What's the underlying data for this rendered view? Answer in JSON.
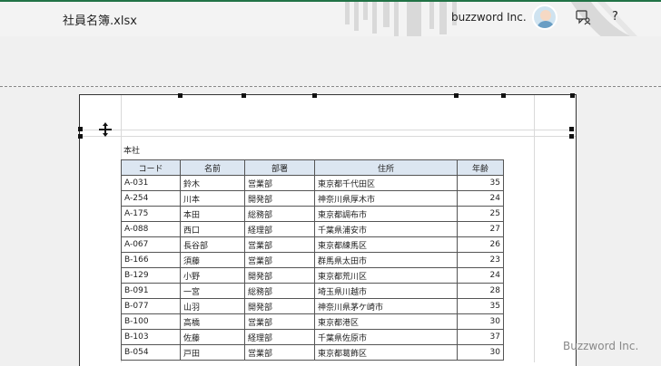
{
  "titlebar": {
    "filename": "社員名簿.xlsx",
    "username": "buzzword Inc.",
    "help": "?"
  },
  "sheet": {
    "label": "本社",
    "headers": [
      "コード",
      "名前",
      "部署",
      "住所",
      "年齢"
    ],
    "rows": [
      [
        "A-031",
        "鈴木",
        "営業部",
        "東京都千代田区",
        "35"
      ],
      [
        "A-254",
        "川本",
        "開発部",
        "神奈川県厚木市",
        "24"
      ],
      [
        "A-175",
        "本田",
        "総務部",
        "東京都調布市",
        "25"
      ],
      [
        "A-088",
        "西口",
        "経理部",
        "千葉県浦安市",
        "27"
      ],
      [
        "A-067",
        "長谷部",
        "営業部",
        "東京都練馬区",
        "26"
      ],
      [
        "B-166",
        "須藤",
        "営業部",
        "群馬県太田市",
        "23"
      ],
      [
        "B-129",
        "小野",
        "開発部",
        "東京都荒川区",
        "24"
      ],
      [
        "B-091",
        "一宮",
        "総務部",
        "埼玉県川越市",
        "28"
      ],
      [
        "B-077",
        "山羽",
        "開発部",
        "神奈川県茅ケ崎市",
        "35"
      ],
      [
        "B-100",
        "高橋",
        "営業部",
        "東京都港区",
        "30"
      ],
      [
        "B-103",
        "佐藤",
        "経理部",
        "千葉県佐原市",
        "37"
      ],
      [
        "B-054",
        "戸田",
        "営業部",
        "東京都葛飾区",
        "30"
      ]
    ]
  },
  "watermark": "Buzzword Inc.",
  "colors": {
    "accent": "#217346",
    "header_fill": "#dce6f1"
  }
}
